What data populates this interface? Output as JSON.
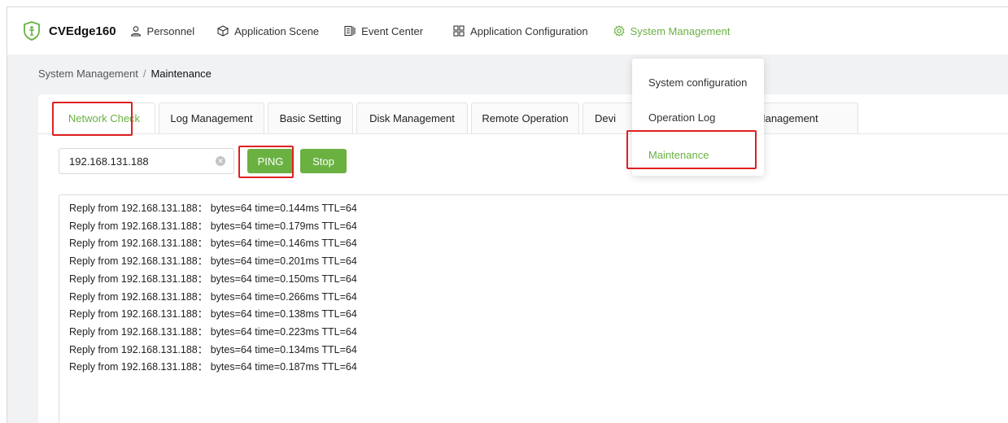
{
  "app": {
    "name": "CVEdge160",
    "accent_color": "#6ab142",
    "highlight_color": "#e02020"
  },
  "nav": {
    "items": [
      {
        "label": "Personnel",
        "icon": "person-icon"
      },
      {
        "label": "Application Scene",
        "icon": "cube-icon"
      },
      {
        "label": "Event Center",
        "icon": "event-icon"
      },
      {
        "label": "Application Configuration",
        "icon": "grid-icon"
      },
      {
        "label": "System Management",
        "icon": "gear-icon",
        "active": true
      }
    ]
  },
  "breadcrumb": {
    "parent": "System Management",
    "separator": "/",
    "current": "Maintenance"
  },
  "tabs": [
    {
      "label": "Network Check",
      "active": true
    },
    {
      "label": "Log Management"
    },
    {
      "label": "Basic Setting"
    },
    {
      "label": "Disk Management"
    },
    {
      "label": "Remote Operation"
    },
    {
      "label": "Devi"
    },
    {
      "label": "rm Management"
    }
  ],
  "network_check": {
    "ip_value": "192.168.131.188",
    "ping_label": "PING",
    "stop_label": "Stop",
    "output_lines": [
      "Reply from 192.168.131.188： bytes=64 time=0.144ms TTL=64",
      "Reply from 192.168.131.188： bytes=64 time=0.179ms TTL=64",
      "Reply from 192.168.131.188： bytes=64 time=0.146ms TTL=64",
      "Reply from 192.168.131.188： bytes=64 time=0.201ms TTL=64",
      "Reply from 192.168.131.188： bytes=64 time=0.150ms TTL=64",
      "Reply from 192.168.131.188： bytes=64 time=0.266ms TTL=64",
      "Reply from 192.168.131.188： bytes=64 time=0.138ms TTL=64",
      "Reply from 192.168.131.188： bytes=64 time=0.223ms TTL=64",
      "Reply from 192.168.131.188： bytes=64 time=0.134ms TTL=64",
      "Reply from 192.168.131.188： bytes=64 time=0.187ms TTL=64"
    ]
  },
  "dropdown": {
    "items": [
      {
        "label": "System configuration"
      },
      {
        "label": "Operation Log"
      },
      {
        "label": "Maintenance",
        "active": true
      }
    ]
  }
}
